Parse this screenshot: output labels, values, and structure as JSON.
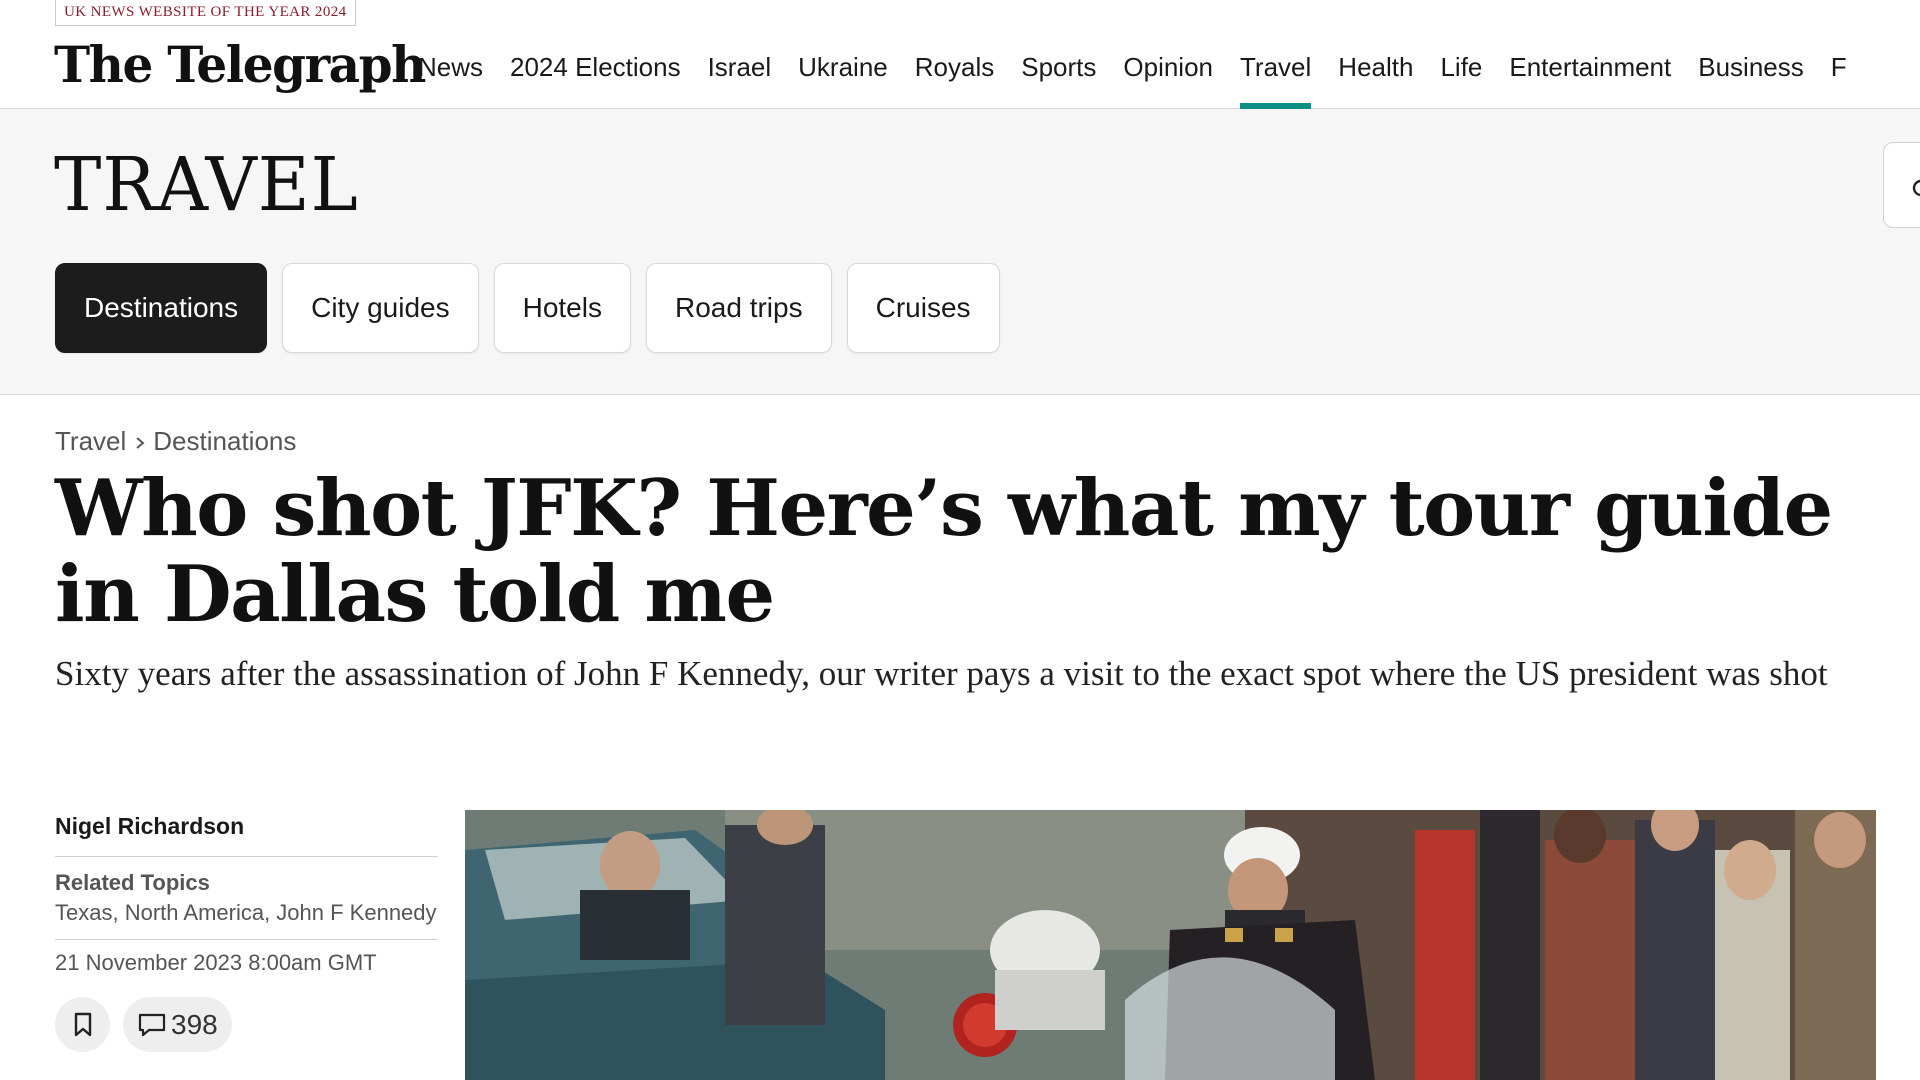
{
  "header": {
    "award": "UK NEWS WEBSITE OF THE YEAR 2024",
    "logo": "The Telegraph",
    "nav": [
      {
        "label": "News"
      },
      {
        "label": "2024 Elections"
      },
      {
        "label": "Israel"
      },
      {
        "label": "Ukraine"
      },
      {
        "label": "Royals"
      },
      {
        "label": "Sports"
      },
      {
        "label": "Opinion"
      },
      {
        "label": "Travel",
        "active": true
      },
      {
        "label": "Health"
      },
      {
        "label": "Life"
      },
      {
        "label": "Entertainment"
      },
      {
        "label": "Business"
      },
      {
        "label": "F"
      }
    ],
    "accent_color": "#0d8f85"
  },
  "section": {
    "title": "TRAVEL",
    "chips": [
      {
        "label": "Destinations",
        "active": true
      },
      {
        "label": "City guides"
      },
      {
        "label": "Hotels"
      },
      {
        "label": "Road trips"
      },
      {
        "label": "Cruises"
      }
    ],
    "search_icon": "search-icon"
  },
  "article": {
    "breadcrumb": [
      "Travel",
      "Destinations"
    ],
    "headline": "Who shot JFK? Here’s what my tour guide in Dallas told me",
    "standfirst": "Sixty years after the assassination of John F Kennedy, our writer pays a visit to the exact spot where the US president was shot",
    "author": "Nigel Richardson",
    "related_label": "Related Topics",
    "related_topics": "Texas, North America, John F Kennedy",
    "date": "21 November 2023 8:00am GMT",
    "comment_count": "398",
    "save_icon": "bookmark-icon",
    "comment_icon": "comment-icon"
  }
}
